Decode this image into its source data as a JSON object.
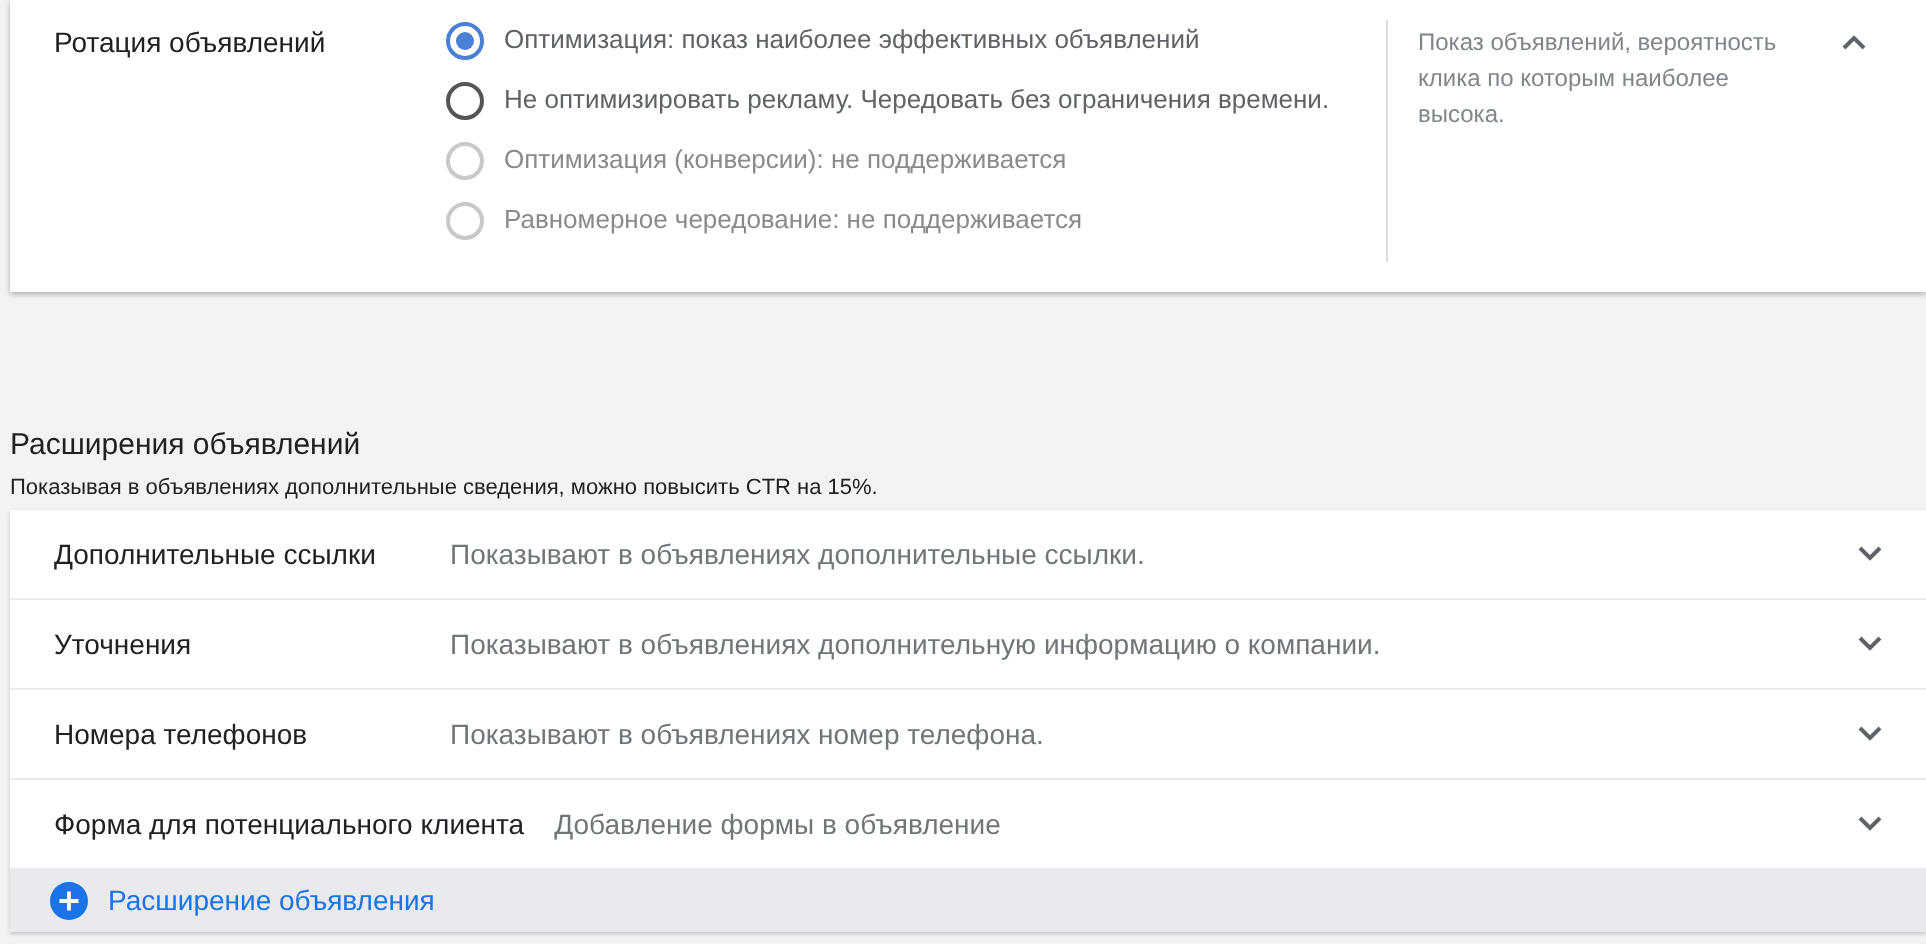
{
  "rotation": {
    "label": "Ротация объявлений",
    "expanded": true,
    "options": [
      {
        "label": "Оптимизация: показ наиболее эффективных объявлений",
        "selected": true,
        "disabled": false
      },
      {
        "label": "Не оптимизировать рекламу. Чередовать без ограничения времени.",
        "selected": false,
        "disabled": false
      },
      {
        "label": "Оптимизация (конверсии): не поддерживается",
        "selected": false,
        "disabled": true
      },
      {
        "label": "Равномерное чередование: не поддерживается",
        "selected": false,
        "disabled": true
      }
    ],
    "description": "Показ объявлений, вероятность клика по которым наиболее высока."
  },
  "extensions": {
    "title": "Расширения объявлений",
    "subtitle": "Показывая в объявлениях дополнительные сведения, можно повысить CTR на 15%.",
    "rows": [
      {
        "label": "Дополнительные ссылки",
        "description": "Показывают в объявлениях дополнительные ссылки.",
        "expanded": false
      },
      {
        "label": "Уточнения",
        "description": "Показывают в объявлениях дополнительную информацию о компании.",
        "expanded": false
      },
      {
        "label": "Номера телефонов",
        "description": "Показывают в объявлениях номер телефона.",
        "expanded": false
      },
      {
        "label": "Форма для потенциального клиента",
        "description": "Добавление формы в объявление",
        "expanded": false
      }
    ],
    "add_button": "Расширение объявления"
  }
}
